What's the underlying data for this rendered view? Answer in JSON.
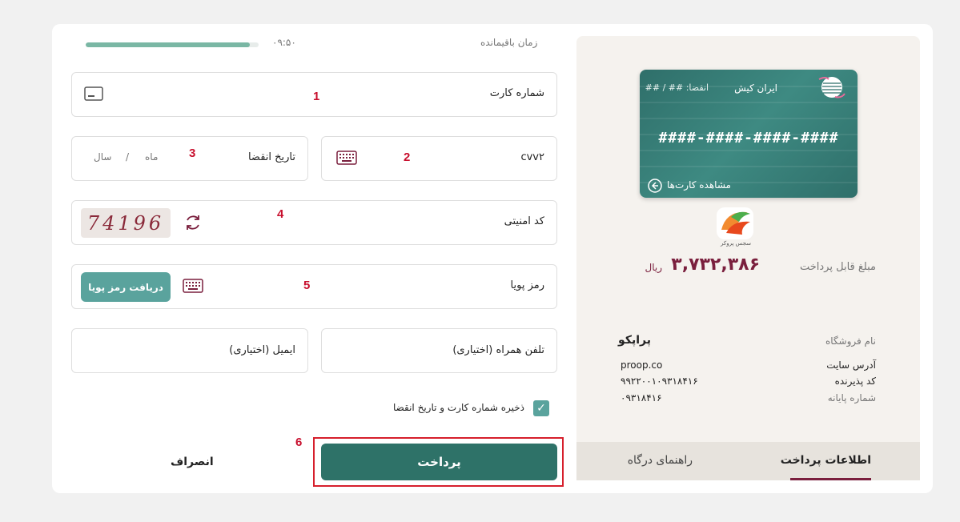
{
  "timer": {
    "label": "زمان باقیمانده",
    "value": "۰۹:۵۰",
    "progress": 0.95
  },
  "form": {
    "card_number_label": "شماره کارت",
    "cvv2_label": "cvv۲",
    "expiry_label": "تاریخ انقضا",
    "expiry_month": "ماه",
    "expiry_sep": "/",
    "expiry_year": "سال",
    "captcha_label": "کد امنیتی",
    "captcha_text": "74196",
    "otp_label": "رمز پویا",
    "otp_button": "دریافت رمز پویا",
    "mobile_label": "تلفن همراه (اختیاری)",
    "email_label": "ایمیل (اختیاری)",
    "save_label": "ذخیره شماره کارت و تاریخ انقضا",
    "save_checked": true,
    "pay_button": "پرداخت",
    "cancel_button": "انصراف"
  },
  "annotations": {
    "n1": "1",
    "n2": "2",
    "n3": "3",
    "n4": "4",
    "n5": "5",
    "n6": "6"
  },
  "card": {
    "bank_name": "ایران کیش",
    "expiry": "انقضا: ## / ##",
    "number": "####-####-####-####",
    "view_cards": "مشاهده کارت‌ها"
  },
  "merchant": {
    "logo_text": "سجس پروکر",
    "amount_label": "مبلغ قابل پرداخت",
    "amount": "۳,۷۳۲,۳۸۶",
    "currency": "ریال",
    "store_name_label": "نام فروشگاه",
    "store_name": "پراپکو",
    "site_label": "آدرس سایت",
    "site": "proop.co",
    "acceptor_label": "کد پذیرنده",
    "acceptor": "۹۹۲۲۰۰۱۰۹۳۱۸۴۱۶",
    "terminal_label": "شماره پایانه",
    "terminal": "۰۹۳۱۸۴۱۶"
  },
  "tabs": {
    "payment_info": "اطلاعات پرداخت",
    "gateway_guide": "راهنمای درگاه"
  },
  "colors": {
    "primary": "#2e7268",
    "accent": "#5aa39d",
    "amount": "#7a1f3d",
    "highlight": "#d61f2c"
  }
}
